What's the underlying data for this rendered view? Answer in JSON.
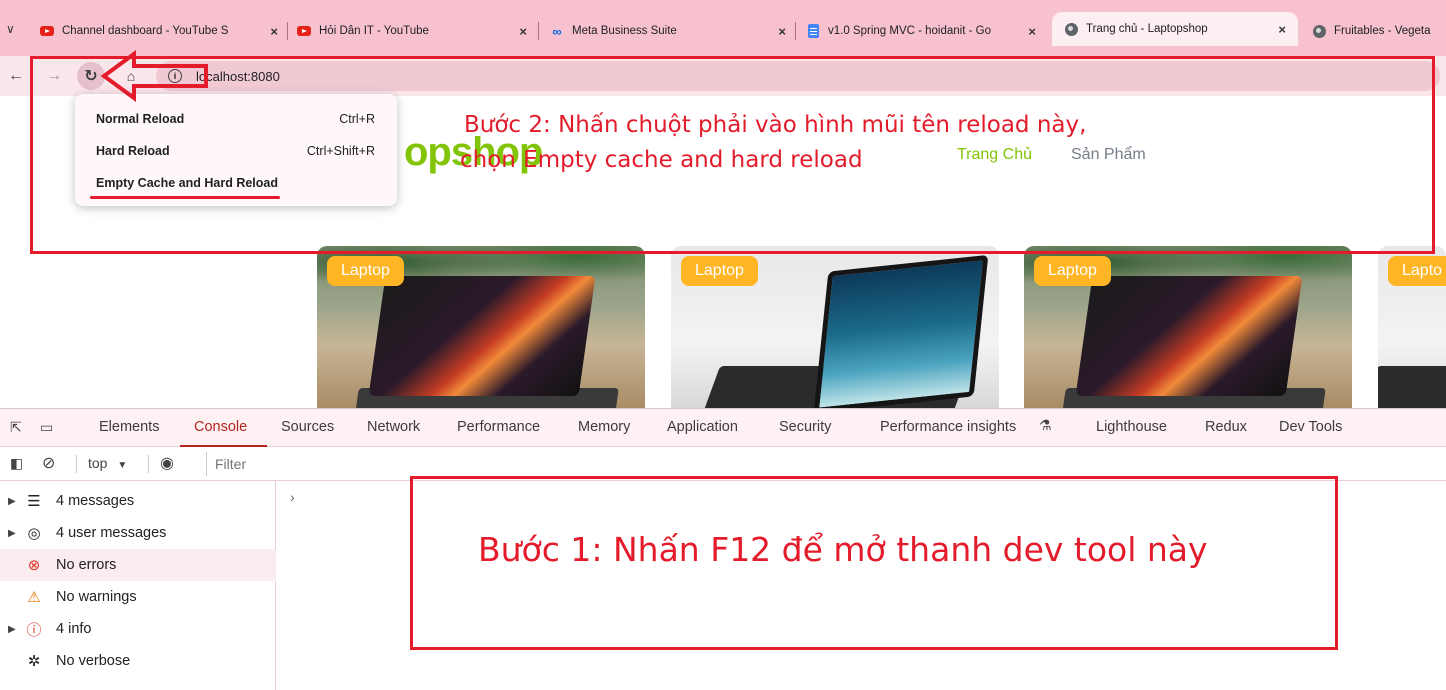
{
  "browser": {
    "tabs": [
      {
        "title": "Channel dashboard - YouTube S",
        "icon": "youtube-icon"
      },
      {
        "title": "Hỏi Dân IT - YouTube",
        "icon": "youtube-icon"
      },
      {
        "title": "Meta Business Suite",
        "icon": "meta-icon"
      },
      {
        "title": "v1.0 Spring MVC - hoidanit - Go",
        "icon": "google-docs-icon"
      },
      {
        "title": "Trang chủ - Laptopshop",
        "icon": "globe-icon",
        "active": true
      },
      {
        "title": "Fruitables - Vegeta",
        "icon": "globe-icon"
      }
    ],
    "tab_menu_icon": "∨",
    "close_glyph": "×",
    "address": "localhost:8080"
  },
  "context_menu": {
    "items": [
      {
        "label": "Normal Reload",
        "shortcut": "Ctrl+R"
      },
      {
        "label": "Hard Reload",
        "shortcut": "Ctrl+Shift+R"
      },
      {
        "label": "Empty Cache and Hard Reload",
        "shortcut": ""
      }
    ]
  },
  "site": {
    "brand_fragment": "opshop",
    "nav": {
      "home": "Trang Chủ",
      "products": "Sản Phẩm"
    },
    "products": [
      {
        "badge": "Laptop"
      },
      {
        "badge": "Laptop"
      },
      {
        "badge": "Laptop"
      },
      {
        "badge": "Lapto"
      }
    ]
  },
  "annotations": {
    "step2_line1": "Bước 2: Nhấn chuột phải vào hình mũi tên reload này,",
    "step2_line2": "chọn Empty cache and hard reload",
    "step1": "Bước 1: Nhấn F12 để mở thanh dev tool này"
  },
  "devtools": {
    "tabs": [
      "Elements",
      "Console",
      "Sources",
      "Network",
      "Performance",
      "Memory",
      "Application",
      "Security",
      "Performance insights",
      "Lighthouse",
      "Redux",
      "Dev Tools"
    ],
    "active_tab": "Console",
    "context_selector": "top",
    "filter_placeholder": "Filter",
    "sidebar": [
      {
        "label": "4 messages",
        "icon": "list-icon",
        "expandable": true
      },
      {
        "label": "4 user messages",
        "icon": "user-circle-icon",
        "expandable": true
      },
      {
        "label": "No errors",
        "icon": "error-icon",
        "expandable": false,
        "selected": true
      },
      {
        "label": "No warnings",
        "icon": "warning-icon",
        "expandable": false
      },
      {
        "label": "4 info",
        "icon": "info-icon",
        "expandable": true
      },
      {
        "label": "No verbose",
        "icon": "bug-icon",
        "expandable": false
      }
    ],
    "prompt": "›"
  },
  "colors": {
    "annotation_red": "#e31b2a",
    "brand_green": "#81c408",
    "badge_orange": "#ffb524",
    "tab_strip": "#f7c1cf",
    "devtools_active": "#b3261e"
  }
}
